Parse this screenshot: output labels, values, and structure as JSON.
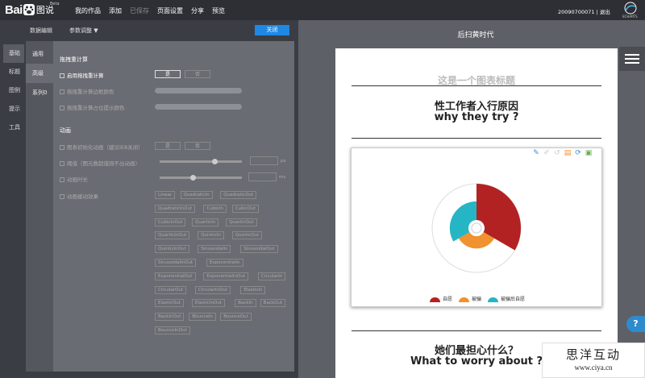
{
  "brand": {
    "bai": "Bai",
    "tu": "图说",
    "beta": "Beta"
  },
  "topmenu": [
    "我的作品",
    "添加",
    "已保存",
    "页面设置",
    "分享",
    "预览"
  ],
  "user": {
    "id": "20090700071",
    "sep": "|",
    "logout": "退出"
  },
  "echarts_label": "ECHARTS",
  "subbar": {
    "data_edit": "数据编辑",
    "param_adjust": "参数调整 ▼",
    "close": "关闭"
  },
  "nav1": [
    "基础",
    "标题",
    "图例",
    "提示",
    "工具"
  ],
  "nav2": [
    "通用",
    "高级",
    "系列0"
  ],
  "form": {
    "drag_title": "拖拽重计算",
    "enable_drag": "启用拖拽重计算",
    "yes": "是",
    "no": "否",
    "drag_border": "拖拽重计算边框颜色",
    "drag_fill": "拖拽重计算占位提示颜色",
    "anim_title": "动画",
    "init_anim": "图表初始化动画（建议IE8关闭）",
    "threshold": "阈值（图元数超值则不出动画）",
    "threshold_unit": "px",
    "duration": "动画时长",
    "duration_unit": "ms",
    "easing": "动画缓动效果",
    "easings": [
      [
        "Linear",
        "QuadraticIn",
        "QuadraticOut"
      ],
      [
        "QuadraticInOut",
        "CubicIn",
        "CubicOut"
      ],
      [
        "CubicInOut",
        "QuarticIn",
        "QuarticOut"
      ],
      [
        "QuarticInOut",
        "QuinticIn",
        "QuinticOut"
      ],
      [
        "QuinticInOut",
        "SinusoidalIn",
        "SinusoidalOut"
      ],
      [
        "SinusoidalInOut",
        "ExponentialIn"
      ],
      [
        "ExponentialOut",
        "ExponentialInOut",
        "CircularIn"
      ],
      [
        "CircularOut",
        "CircularInOut",
        "ElasticIn"
      ],
      [
        "ElasticOut",
        "ElasticInOut",
        "BackIn",
        "BackOut"
      ],
      [
        "BackInOut",
        "BounceIn",
        "BounceOut"
      ],
      [
        "BounceInOut"
      ]
    ]
  },
  "preview": {
    "title": "后扫黄时代",
    "chart_title": "这是一个图表标题",
    "h1": "性工作者入行原因",
    "h2": "why they try ?",
    "h3": "她们最担心什么？",
    "h4": "What to worry about ?",
    "help": "?"
  },
  "chart_data": {
    "type": "pie",
    "subtype": "rose",
    "series": [
      {
        "name": "自愿",
        "color": "#b22222",
        "values": [
          35
        ]
      },
      {
        "name": "被骗",
        "color": "#f0922f",
        "values": [
          12
        ]
      },
      {
        "name": "被骗后自愿",
        "color": "#26b5c4",
        "values": [
          18
        ]
      }
    ],
    "legend_position": "bottom"
  },
  "watermark": {
    "line1": "思洋互动",
    "line2": "www.ciya.cn"
  }
}
